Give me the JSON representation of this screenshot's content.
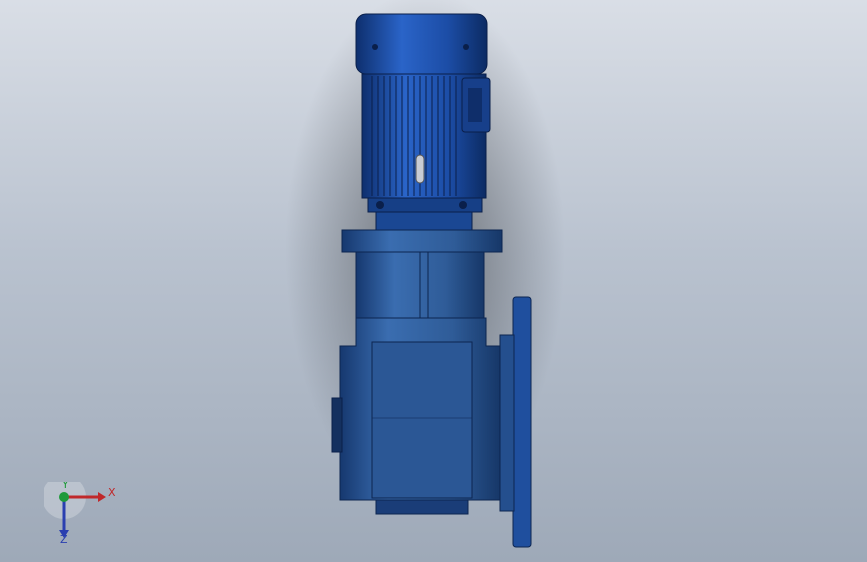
{
  "scene": {
    "description_free": true,
    "background_top": "#d9dee6",
    "background_bottom": "#9ea9b8",
    "model_color_dark": "#1a3d78",
    "model_color_main": "#2f5fa3",
    "motor_color": "#1c55b8",
    "triad_x_color": "#c0282a",
    "triad_y_color": "#1f9a3a",
    "triad_z_color": "#2a3fb0"
  },
  "triad": {
    "x_label": "X",
    "y_label": "Y",
    "z_label": "Z"
  }
}
